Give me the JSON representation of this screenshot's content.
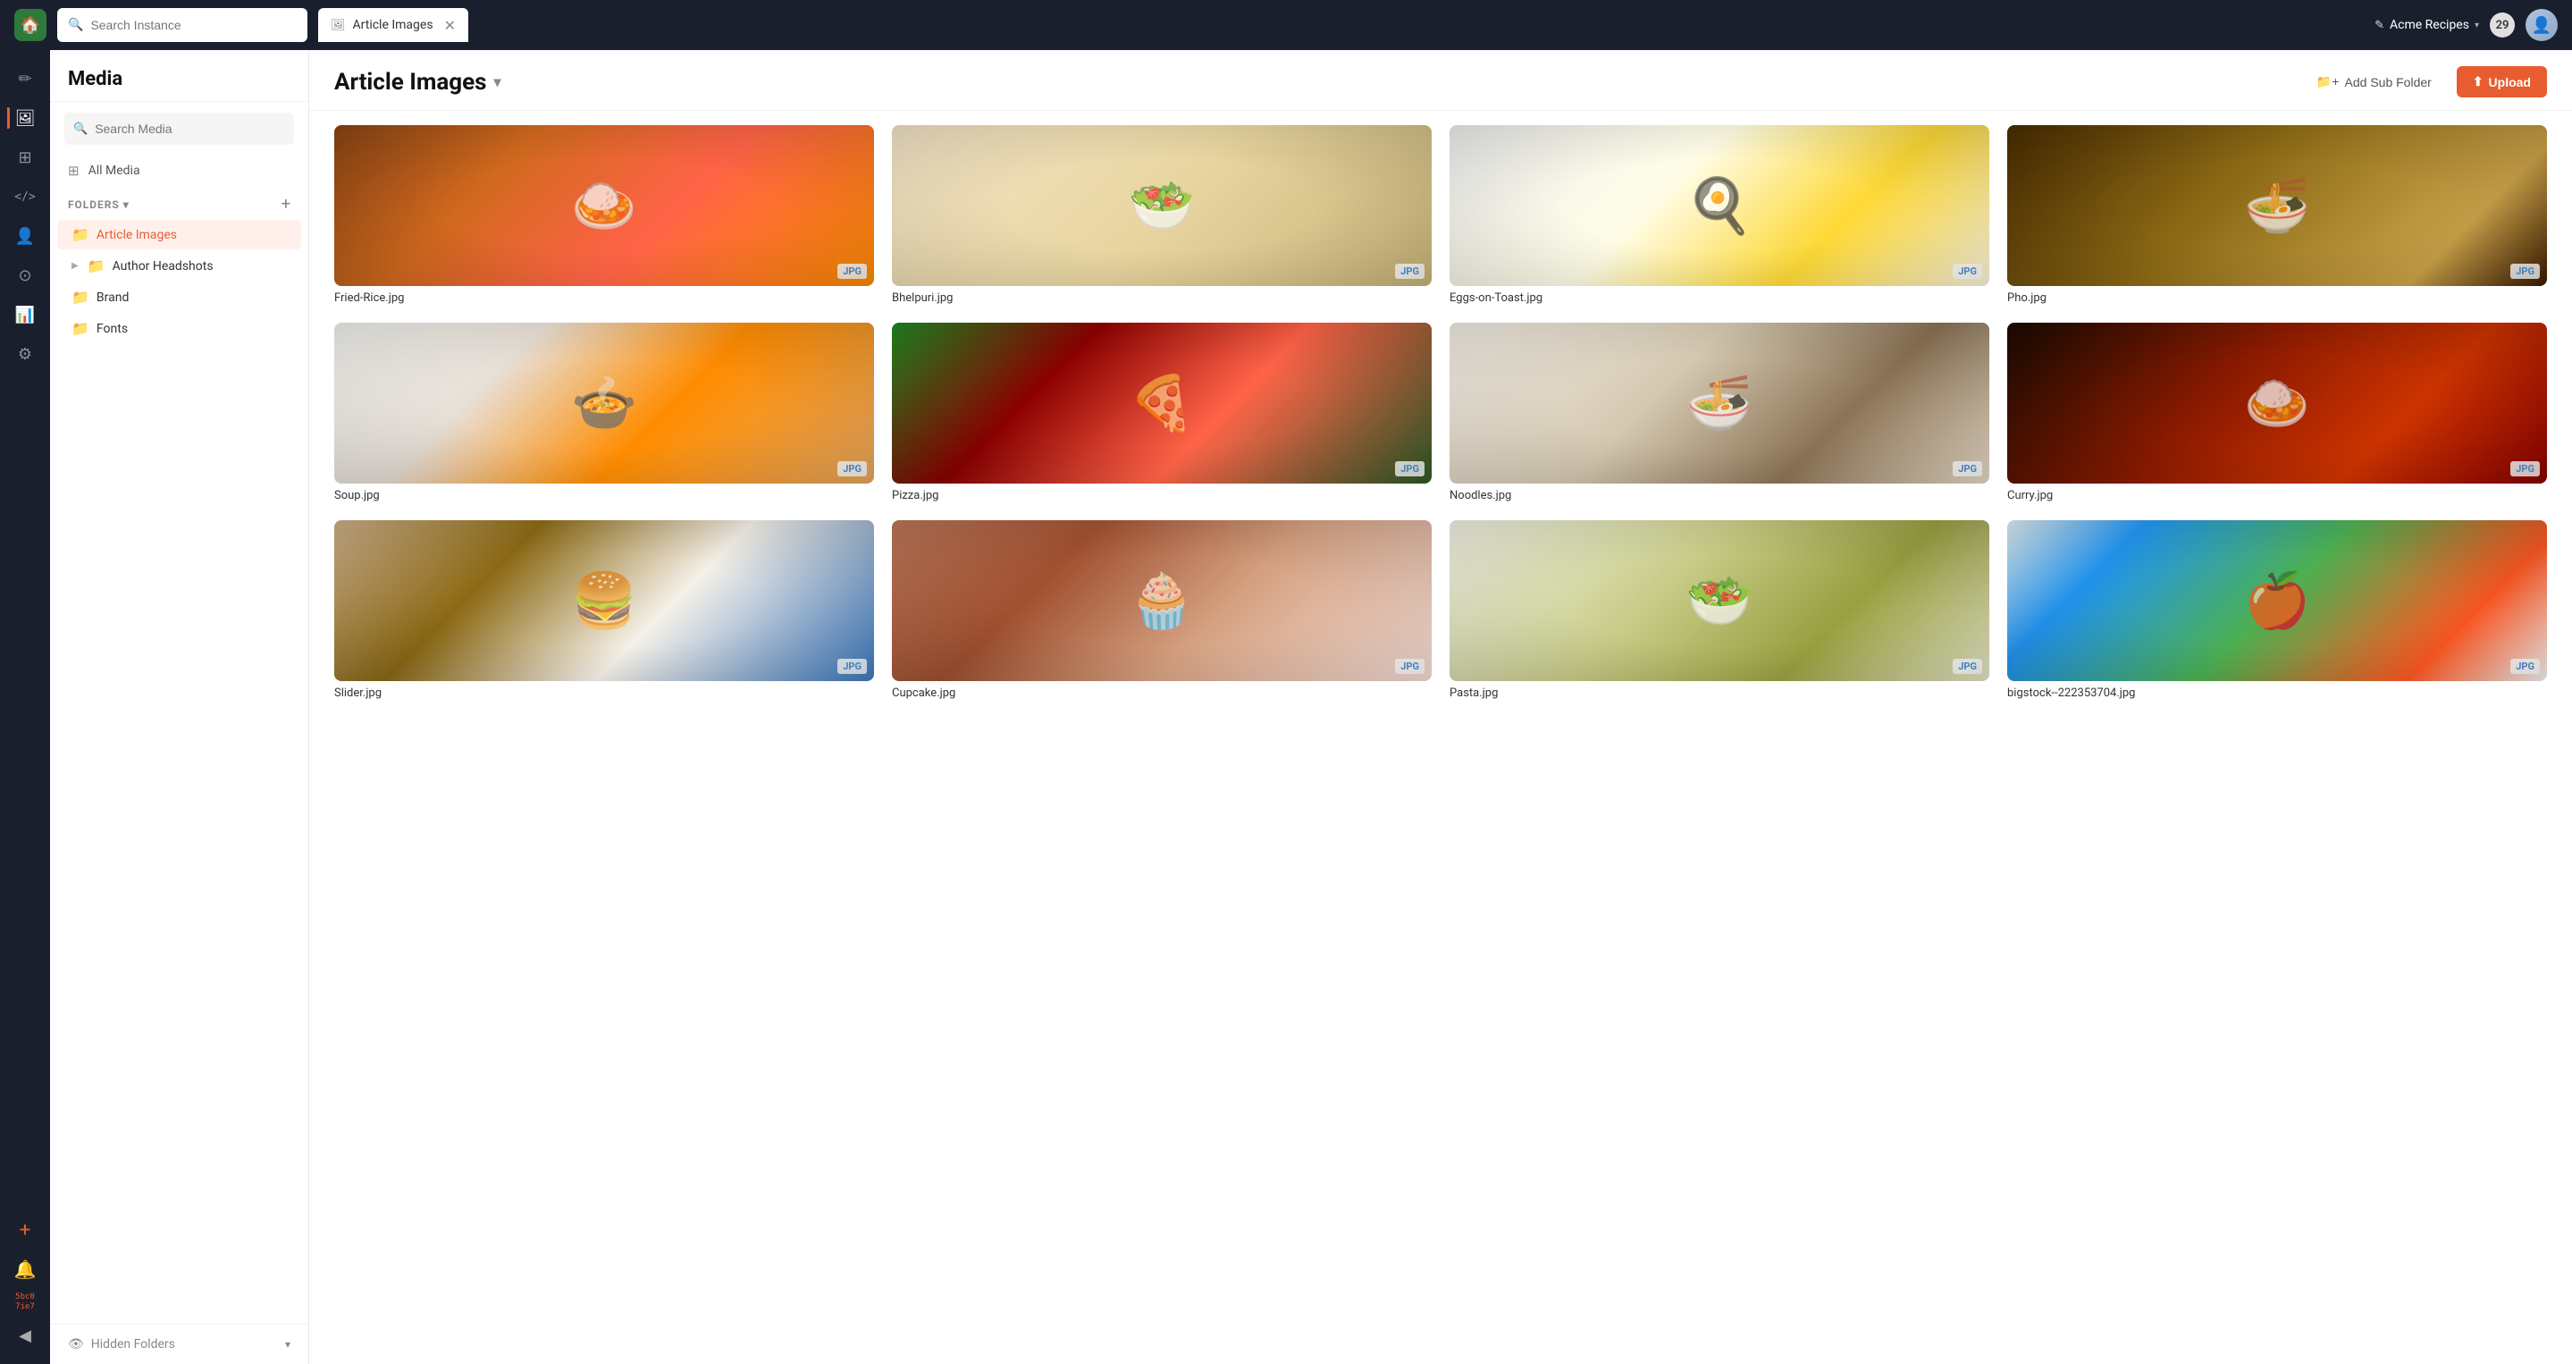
{
  "topbar": {
    "logo_icon": "🏠",
    "search_placeholder": "Search Instance",
    "tab_label": "Article Images",
    "tab_icon": "🖼",
    "instance_name": "Acme Recipes",
    "notif_count": "29",
    "edit_icon": "✎"
  },
  "sidebar_icons": [
    {
      "name": "edit-icon",
      "icon": "✏",
      "active": false
    },
    {
      "name": "media-icon",
      "icon": "🖼",
      "active": true
    },
    {
      "name": "database-icon",
      "icon": "⊞",
      "active": false
    },
    {
      "name": "code-icon",
      "icon": "</>",
      "active": false
    },
    {
      "name": "contacts-icon",
      "icon": "👤",
      "active": false
    },
    {
      "name": "settings-icon-2",
      "icon": "⊙",
      "active": false
    },
    {
      "name": "chart-icon",
      "icon": "📊",
      "active": false
    },
    {
      "name": "gear-icon",
      "icon": "⚙",
      "active": false
    }
  ],
  "sidebar_bottom": [
    {
      "name": "plus-icon",
      "icon": "+"
    },
    {
      "name": "notification-icon",
      "icon": "🔔"
    },
    {
      "name": "expand-icon",
      "icon": "◀"
    }
  ],
  "sidebar_badge": "5bc0\n7ie7",
  "media_sidebar": {
    "title": "Media",
    "search_placeholder": "Search Media",
    "all_media_label": "All Media",
    "folders_label": "FOLDERS",
    "folders_add": "+",
    "folders": [
      {
        "name": "Article Images",
        "active": true,
        "has_expand": false,
        "icon_type": "red"
      },
      {
        "name": "Author Headshots",
        "active": false,
        "has_expand": true,
        "icon_type": "gray"
      },
      {
        "name": "Brand",
        "active": false,
        "has_expand": false,
        "icon_type": "gray"
      },
      {
        "name": "Fonts",
        "active": false,
        "has_expand": false,
        "icon_type": "gray"
      }
    ],
    "hidden_folders_label": "Hidden Folders"
  },
  "main": {
    "title": "Article Images",
    "add_subfolder_label": "Add Sub Folder",
    "upload_label": "Upload",
    "images": [
      {
        "name": "Fried-Rice.jpg",
        "badge": "JPG",
        "style": "friedrice",
        "emoji": "🍛"
      },
      {
        "name": "Bhelpuri.jpg",
        "badge": "JPG",
        "style": "bhelpuri",
        "emoji": "🥗"
      },
      {
        "name": "Eggs-on-Toast.jpg",
        "badge": "JPG",
        "style": "eggstoast",
        "emoji": "🍳"
      },
      {
        "name": "Pho.jpg",
        "badge": "JPG",
        "style": "pho",
        "emoji": "🍜"
      },
      {
        "name": "Soup.jpg",
        "badge": "JPG",
        "style": "soup",
        "emoji": "🍲"
      },
      {
        "name": "Pizza.jpg",
        "badge": "JPG",
        "style": "pizza",
        "emoji": "🍕"
      },
      {
        "name": "Noodles.jpg",
        "badge": "JPG",
        "style": "noodles",
        "emoji": "🍜"
      },
      {
        "name": "Curry.jpg",
        "badge": "JPG",
        "style": "curry",
        "emoji": "🍛"
      },
      {
        "name": "Slider.jpg",
        "badge": "JPG",
        "style": "slider",
        "emoji": "🍔"
      },
      {
        "name": "Cupcake.jpg",
        "badge": "JPG",
        "style": "cupcake",
        "emoji": "🧁"
      },
      {
        "name": "Pasta.jpg",
        "badge": "JPG",
        "style": "pasta",
        "emoji": "🥗"
      },
      {
        "name": "bigstock--222353704.jpg",
        "badge": "JPG",
        "style": "bigstock",
        "emoji": "🍎"
      }
    ]
  },
  "colors": {
    "accent": "#e85d2f",
    "sidebar_bg": "#1a1f2e",
    "active_folder_bg": "#fff0ec"
  }
}
